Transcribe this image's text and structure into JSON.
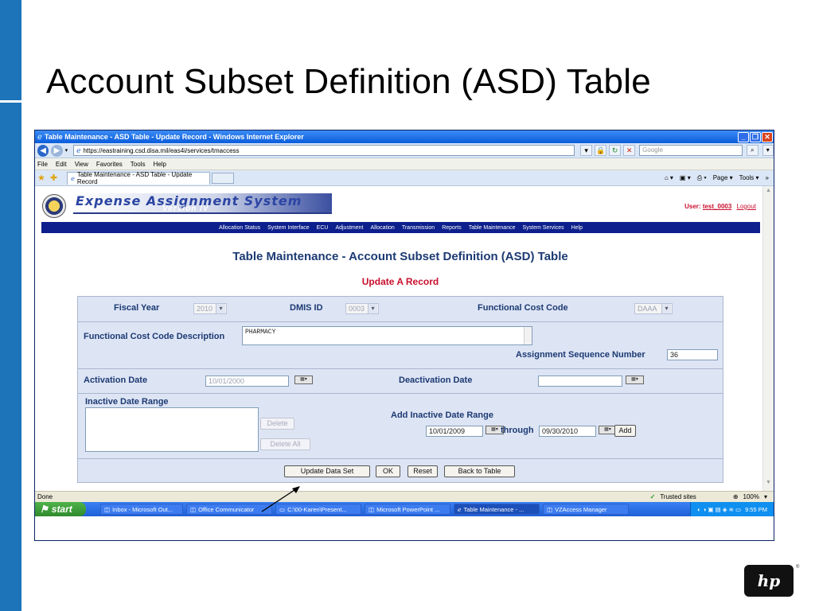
{
  "slide": {
    "title": "Account Subset Definition (ASD) Table",
    "accent_color": "#1e74b8",
    "logo_text": "hp",
    "logo_mark": "®"
  },
  "browser": {
    "window_title": "Table Maintenance - ASD Table - Update Record - Windows Internet Explorer",
    "url": "https://eastraining.csd.disa.mil/eas4i/services/tmaccess",
    "search_placeholder": "Google",
    "menu": [
      "File",
      "Edit",
      "View",
      "Favorites",
      "Tools",
      "Help"
    ],
    "tab_label": "Table Maintenance - ASD Table - Update Record",
    "cmd": {
      "page": "Page ▾",
      "tools": "Tools ▾",
      "more": "»"
    },
    "status_text": "Done",
    "zone": "Trusted sites",
    "zoom": "100%"
  },
  "app": {
    "name": "Expense Assignment System",
    "version": "Version IV",
    "user_label": "User:",
    "user_name": "test_0003",
    "logout": "Logout",
    "nav": [
      "Allocation Status",
      "System Interface",
      "ECU",
      "Adjustment",
      "Allocation",
      "Transmission",
      "Reports",
      "Table Maintenance",
      "System Services",
      "Help"
    ],
    "page_title": "Table Maintenance - Account Subset Definition (ASD) Table",
    "page_subtitle": "Update A Record"
  },
  "form": {
    "fiscal_year_label": "Fiscal Year",
    "fiscal_year_value": "2010",
    "dmis_label": "DMIS ID",
    "dmis_value": "0003",
    "fcc_label": "Functional Cost Code",
    "fcc_value": "DAAA",
    "fcc_desc_label": "Functional Cost Code Description",
    "fcc_desc_value": "PHARMACY",
    "seq_label": "Assignment Sequence Number",
    "seq_value": "36",
    "activation_label": "Activation Date",
    "activation_value": "10/01/2000",
    "deactivation_label": "Deactivation Date",
    "deactivation_value": "",
    "inactive_label": "Inactive Date Range",
    "delete_label": "Delete",
    "delete_all_label": "Delete All",
    "add_range_label": "Add Inactive Date Range",
    "range_from": "10/01/2009",
    "through_label": "through",
    "range_to": "09/30/2010",
    "add_label": "Add",
    "update_label": "Update Data Set",
    "ok_label": "OK",
    "reset_label": "Reset",
    "back_label": "Back to Table"
  },
  "taskbar": {
    "start": "start",
    "items": [
      "Inbox - Microsoft Out...",
      "Office Communicator",
      "C:\\00-Karen\\Present...",
      "Microsoft PowerPoint ...",
      "Table Maintenance - ...",
      "VZAccess Manager"
    ],
    "clock": "9:55 PM"
  }
}
